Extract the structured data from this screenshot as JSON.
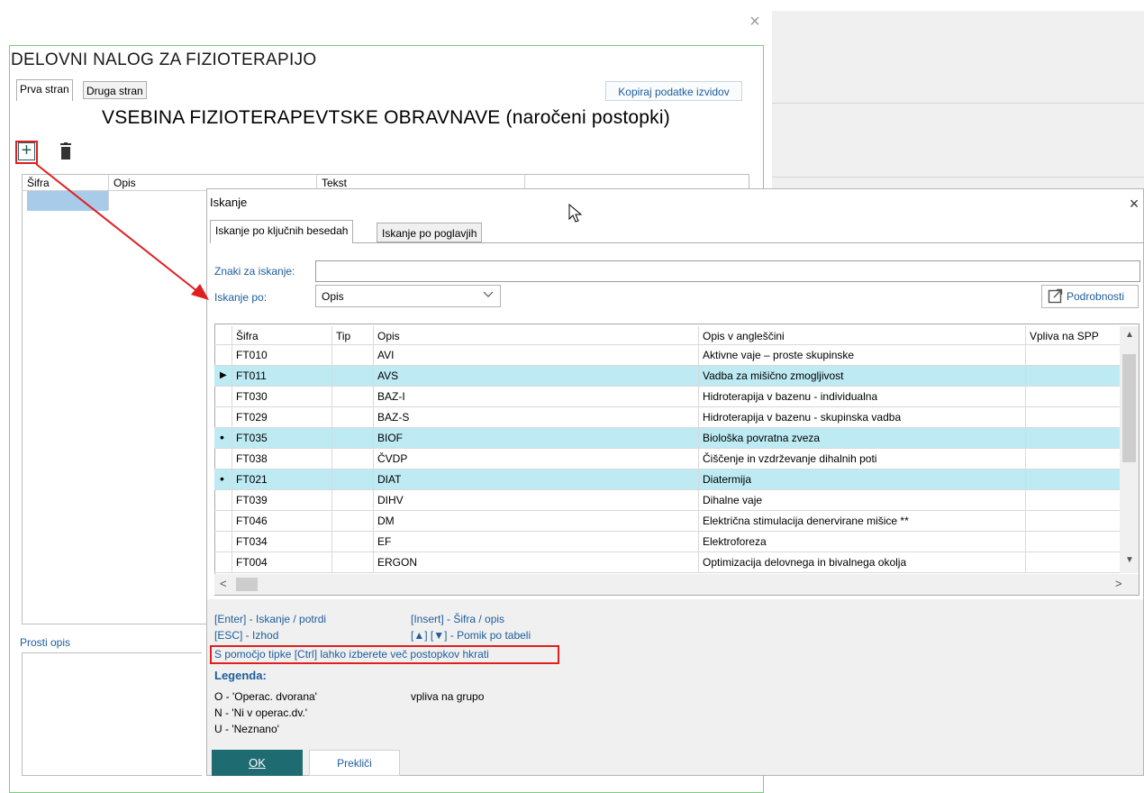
{
  "background_form": {
    "close_glyph": "×",
    "title": "DELOVNI NALOG ZA FIZIOTERAPIJO",
    "tabs": [
      "Prva stran",
      "Druga stran"
    ],
    "copy_button": "Kopiraj podatke izvidov",
    "section_title": "VSEBINA FIZIOTERAPEVTSKE OBRAVNAVE (naročeni postopki)",
    "add_glyph": "+",
    "grid_headers": [
      "Šifra",
      "Opis",
      "Tekst"
    ],
    "prosti_opis_label": "Prosti opis"
  },
  "dialog": {
    "title": "Iskanje",
    "close_glyph": "×",
    "tabs": [
      "Iskanje po ključnih besedah",
      "Iskanje po poglavjih"
    ],
    "search_label": "Znaki za iskanje:",
    "search_value": "",
    "search_by_label": "Iskanje po:",
    "search_by_value": "Opis",
    "details_button": "Podrobnosti",
    "table": {
      "headers": [
        "Šifra",
        "Tip",
        "Opis",
        "Opis v angleščini",
        "Vpliva na SPP"
      ],
      "rows": [
        {
          "sifra": "FT010",
          "tip": "",
          "opis": "AVI",
          "opis_en": "Aktivne vaje – proste skupinske",
          "spp": "",
          "selected": false,
          "marker": ""
        },
        {
          "sifra": "FT011",
          "tip": "",
          "opis": "AVS",
          "opis_en": "Vadba za mišično zmogljivost",
          "spp": "",
          "selected": true,
          "marker": "current"
        },
        {
          "sifra": "FT030",
          "tip": "",
          "opis": "BAZ-I",
          "opis_en": "Hidroterapija v bazenu - individualna",
          "spp": "",
          "selected": false,
          "marker": ""
        },
        {
          "sifra": "FT029",
          "tip": "",
          "opis": "BAZ-S",
          "opis_en": "Hidroterapija v bazenu - skupinska vadba",
          "spp": "",
          "selected": false,
          "marker": ""
        },
        {
          "sifra": "FT035",
          "tip": "",
          "opis": "BIOF",
          "opis_en": "Biološka povratna zveza",
          "spp": "",
          "selected": true,
          "marker": "dot"
        },
        {
          "sifra": "FT038",
          "tip": "",
          "opis": "ČVDP",
          "opis_en": "Čiščenje in vzdrževanje dihalnih poti",
          "spp": "",
          "selected": false,
          "marker": ""
        },
        {
          "sifra": "FT021",
          "tip": "",
          "opis": "DIAT",
          "opis_en": "Diatermija",
          "spp": "",
          "selected": true,
          "marker": "dot"
        },
        {
          "sifra": "FT039",
          "tip": "",
          "opis": "DIHV",
          "opis_en": "Dihalne vaje",
          "spp": "",
          "selected": false,
          "marker": ""
        },
        {
          "sifra": "FT046",
          "tip": "",
          "opis": "DM",
          "opis_en": "Električna stimulacija denervirane mišice **",
          "spp": "",
          "selected": false,
          "marker": ""
        },
        {
          "sifra": "FT034",
          "tip": "",
          "opis": "EF",
          "opis_en": "Elektroforeza",
          "spp": "",
          "selected": false,
          "marker": ""
        },
        {
          "sifra": "FT004",
          "tip": "",
          "opis": "ERGON",
          "opis_en": "Optimizacija delovnega in bivalnega okolja",
          "spp": "",
          "selected": false,
          "marker": ""
        }
      ]
    },
    "scroll": {
      "up": "▲",
      "down": "▼",
      "left": "<",
      "right": ">"
    },
    "tips": {
      "enter": "[Enter] - Iskanje / potrdi",
      "esc": "[ESC]  - Izhod",
      "insert": "[Insert] - Šifra / opis",
      "arrows": "[▲] [▼] - Pomik po tabeli",
      "ctrl": "S pomočjo tipke [Ctrl] lahko izberete več postopkov hkrati"
    },
    "legend": {
      "title": "Legenda:",
      "items": [
        "O - 'Operac. dvorana'",
        "N - 'Ni v operac.dv.'",
        "U - 'Neznano'"
      ],
      "note": "vpliva na grupo"
    },
    "ok_button": "OK",
    "cancel_button": "Prekliči"
  },
  "colors": {
    "accent_red": "#e01f1f",
    "selected_row": "#bdeaf3",
    "label_blue": "#1d5d9b",
    "ok_teal": "#1f6b72",
    "frame_green": "#7fcc7f"
  }
}
